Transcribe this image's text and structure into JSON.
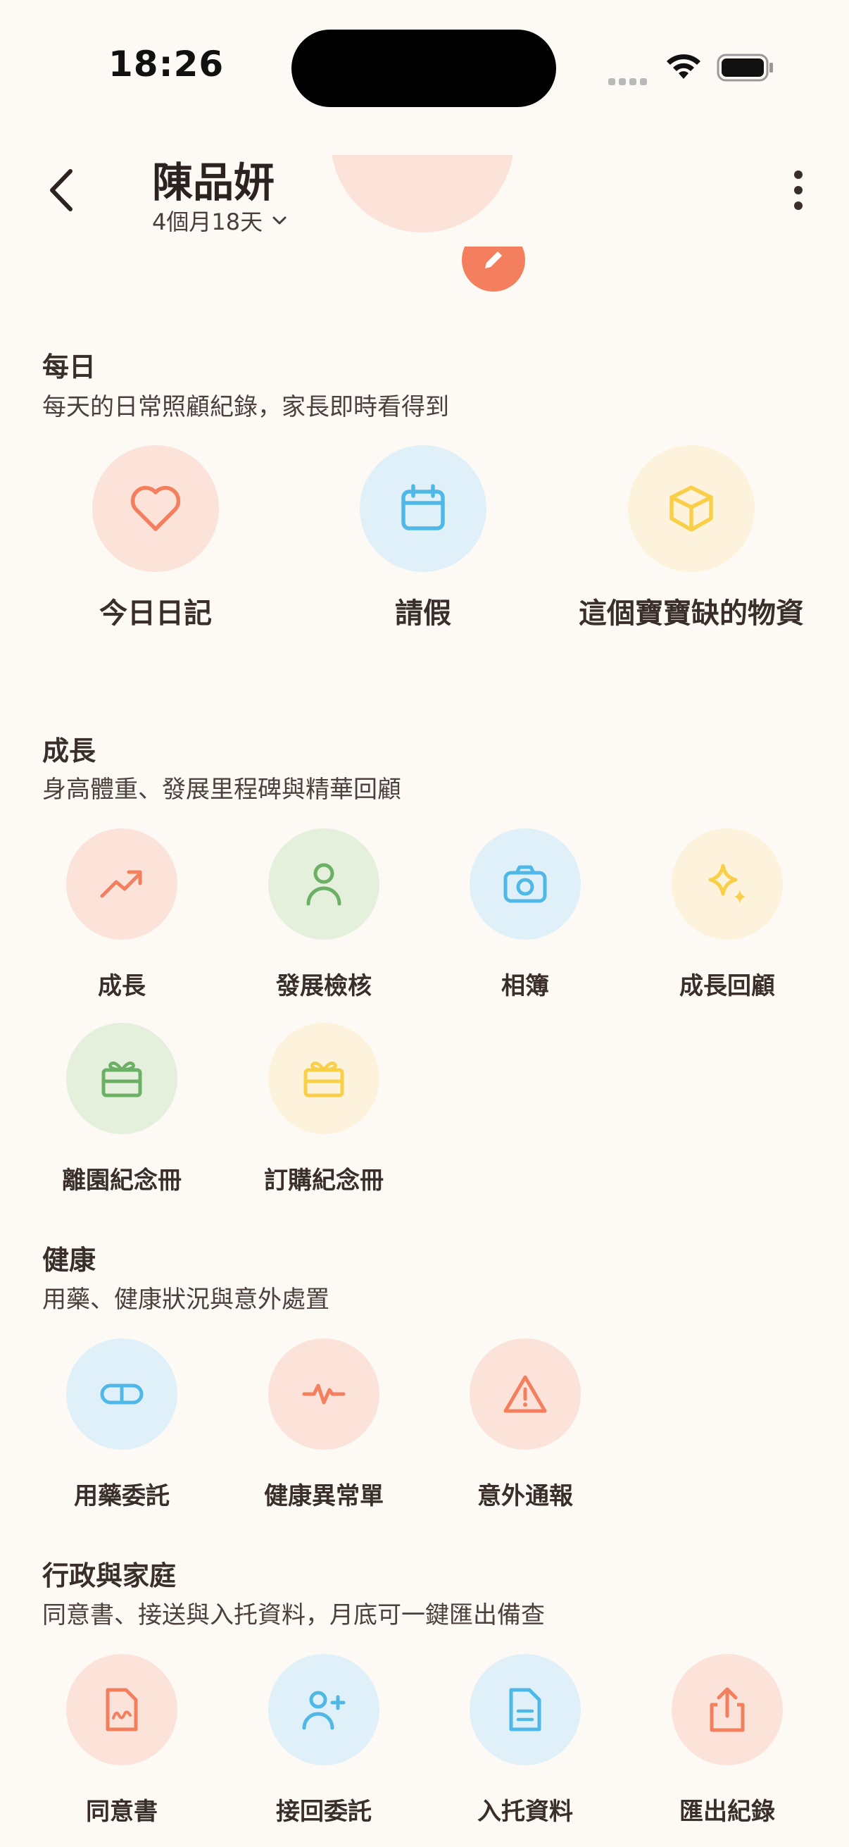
{
  "status_bar": {
    "time": "18:26"
  },
  "header": {
    "name": "陳品妍",
    "age": "4個月18天"
  },
  "colors": {
    "peach": "#F47F5E",
    "blue": "#4FB8E6",
    "yellow": "#F9CF48",
    "green": "#6BB064",
    "background": "#FDFAF5"
  },
  "sections": [
    {
      "title": "每日",
      "desc": "每天的日常照顧紀錄，家長即時看得到",
      "items": [
        {
          "label": "今日日記",
          "icon": "heart-icon"
        },
        {
          "label": "請假",
          "icon": "calendar-icon"
        },
        {
          "label": "這個寶寶缺的物資",
          "icon": "box-icon"
        }
      ]
    },
    {
      "title": "成長",
      "desc": "身高體重、發展里程碑與精華回顧",
      "items": [
        {
          "label": "成長",
          "icon": "trending-up-icon"
        },
        {
          "label": "發展檢核",
          "icon": "person-icon"
        },
        {
          "label": "相簿",
          "icon": "camera-icon"
        },
        {
          "label": "成長回顧",
          "icon": "sparkles-icon"
        },
        {
          "label": "離園紀念冊",
          "icon": "gift-box-icon"
        },
        {
          "label": "訂購紀念冊",
          "icon": "gift-box-icon"
        }
      ]
    },
    {
      "title": "健康",
      "desc": "用藥、健康狀況與意外處置",
      "items": [
        {
          "label": "用藥委託",
          "icon": "pill-icon"
        },
        {
          "label": "健康異常單",
          "icon": "pulse-icon"
        },
        {
          "label": "意外通報",
          "icon": "warning-icon"
        }
      ]
    },
    {
      "title": "行政與家庭",
      "desc": "同意書、接送與入托資料，月底可一鍵匯出備查",
      "items": [
        {
          "label": "同意書",
          "icon": "signed-document-icon"
        },
        {
          "label": "接回委託",
          "icon": "add-person-icon"
        },
        {
          "label": "入托資料",
          "icon": "document-icon"
        },
        {
          "label": "匯出紀錄",
          "icon": "share-export-icon"
        }
      ]
    }
  ]
}
